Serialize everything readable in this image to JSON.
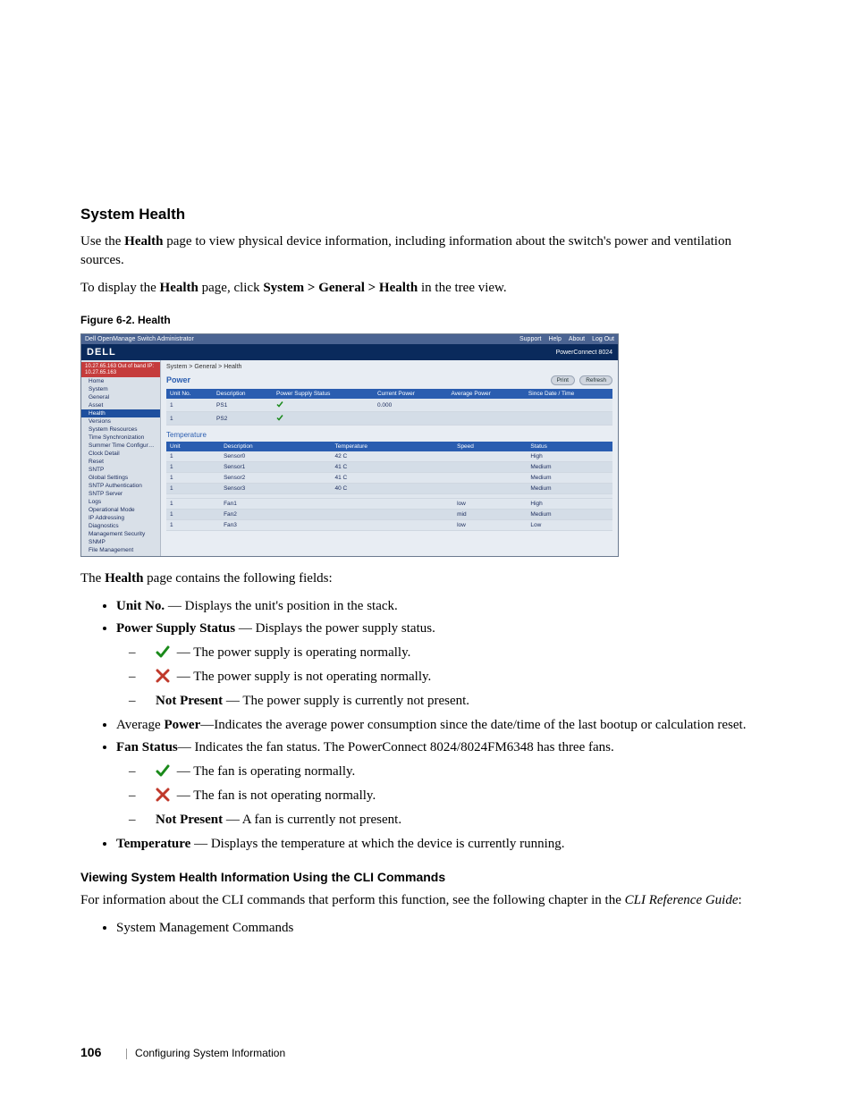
{
  "section": {
    "title": "System Health",
    "intro1_pre": "Use the ",
    "intro1_b1": "Health",
    "intro1_post": " page to view physical device information, including information about the switch's power and ventilation sources.",
    "intro2_pre": "To display the ",
    "intro2_b1": "Health",
    "intro2_mid": " page, click ",
    "intro2_path": "System > General > Health",
    "intro2_post": " in the tree view.",
    "figure_caption": "Figure 6-2.    Health",
    "fields_intro_pre": "The ",
    "fields_intro_b": "Health",
    "fields_intro_post": " page contains the following fields:"
  },
  "bullets": {
    "unit_no_b": "Unit No.",
    "unit_no_t": " — Displays the unit's position in the stack.",
    "pss_b": "Power Supply Status",
    "pss_t": " — Displays the power supply status.",
    "pss_ok": " — The power supply is operating normally.",
    "pss_bad": " — The power supply is not operating normally.",
    "pss_np_b": "Not Present",
    "pss_np_t": " — The power supply is currently not present.",
    "avg_pre": "Average ",
    "avg_b": "Power",
    "avg_t": "—Indicates the average power consumption since the date/time of the last bootup or calculation reset.",
    "fan_b": "Fan Status",
    "fan_t": "— Indicates the fan status. The PowerConnect 8024/8024FM6348 has three fans.",
    "fan_ok": " — The fan is operating normally.",
    "fan_bad": " — The fan is not operating normally.",
    "fan_np_b": "Not Present",
    "fan_np_t": " — A fan is currently not present.",
    "temp_b": "Temperature",
    "temp_t": " — Displays the temperature at which the device is currently running."
  },
  "cli": {
    "heading": "Viewing System Health Information Using the CLI Commands",
    "p_pre": "For information about the CLI commands that perform this function, see the following chapter in the ",
    "p_i": "CLI Reference Guide",
    "p_post": ":",
    "item": "System Management Commands"
  },
  "footer": {
    "page": "106",
    "chapter": "Configuring System Information"
  },
  "mock": {
    "titlebar_left": "Dell OpenManage Switch Administrator",
    "titlebar_right": [
      "Support",
      "Help",
      "About",
      "Log Out"
    ],
    "logo": "DELL",
    "product": "PowerConnect 8024",
    "nav_header": "10.27.65.163\nOut of band IP: 10.27.65.163",
    "nav": [
      {
        "label": "Home",
        "sel": false
      },
      {
        "label": "System",
        "sel": false
      },
      {
        "label": "General",
        "sel": false
      },
      {
        "label": "Asset",
        "sel": false
      },
      {
        "label": "Health",
        "sel": true
      },
      {
        "label": "Versions",
        "sel": false
      },
      {
        "label": "System Resources",
        "sel": false
      },
      {
        "label": "Time Synchronization",
        "sel": false
      },
      {
        "label": "Summer Time Configuration",
        "sel": false
      },
      {
        "label": "Clock Detail",
        "sel": false
      },
      {
        "label": "Reset",
        "sel": false
      },
      {
        "label": "SNTP",
        "sel": false
      },
      {
        "label": "Global Settings",
        "sel": false
      },
      {
        "label": "SNTP Authentication",
        "sel": false
      },
      {
        "label": "SNTP Server",
        "sel": false
      },
      {
        "label": "Logs",
        "sel": false
      },
      {
        "label": "Operational Mode",
        "sel": false
      },
      {
        "label": "IP Addressing",
        "sel": false
      },
      {
        "label": "Diagnostics",
        "sel": false
      },
      {
        "label": "Management Security",
        "sel": false
      },
      {
        "label": "SNMP",
        "sel": false
      },
      {
        "label": "File Management",
        "sel": false
      }
    ],
    "crumb": "System > General > Health",
    "panel_title": "Power",
    "btn_print": "Print",
    "btn_refresh": "Refresh",
    "power_headers": [
      "Unit No.",
      "Description",
      "Power Supply Status",
      "Current Power",
      "Average Power",
      "Since Date / Time"
    ],
    "power_rows": [
      [
        "1",
        "PS1",
        "ok",
        "0.000",
        "",
        ""
      ],
      [
        "1",
        "PS2",
        "ok",
        "",
        "",
        ""
      ]
    ],
    "temp_title": "Temperature",
    "temp_headers": [
      "Unit",
      "Description",
      "Temperature",
      "Speed",
      "Status"
    ],
    "temp_rows": [
      [
        "1",
        "Sensor0",
        "42 C",
        "",
        "High"
      ],
      [
        "1",
        "Sensor1",
        "41 C",
        "",
        "Medium"
      ],
      [
        "1",
        "Sensor2",
        "41 C",
        "",
        "Medium"
      ],
      [
        "1",
        "Sensor3",
        "40 C",
        "",
        "Medium"
      ]
    ],
    "fan_rows": [
      [
        "1",
        "Fan1",
        "",
        "low",
        "High"
      ],
      [
        "1",
        "Fan2",
        "",
        "mid",
        "Medium"
      ],
      [
        "1",
        "Fan3",
        "",
        "low",
        "Low"
      ]
    ]
  }
}
